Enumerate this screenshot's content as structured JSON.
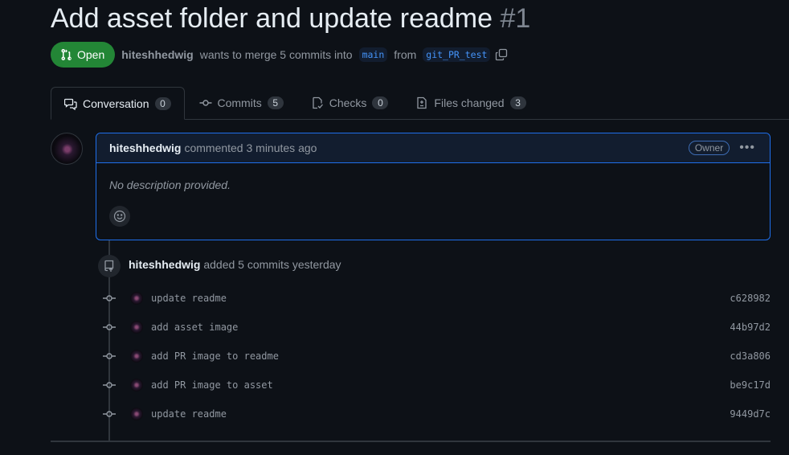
{
  "pr": {
    "title": "Add asset folder and update readme",
    "number": "#1",
    "state": "Open",
    "author": "hiteshhedwig",
    "merge_text": "wants to merge 5 commits into",
    "base_branch": "main",
    "from_text": "from",
    "head_branch": "git_PR_test"
  },
  "tabs": [
    {
      "label": "Conversation",
      "count": "0",
      "icon": "comment-discussion-icon"
    },
    {
      "label": "Commits",
      "count": "5",
      "icon": "git-commit-icon"
    },
    {
      "label": "Checks",
      "count": "0",
      "icon": "checklist-icon"
    },
    {
      "label": "Files changed",
      "count": "3",
      "icon": "file-diff-icon"
    }
  ],
  "comment": {
    "author": "hiteshhedwig",
    "action": "commented 3 minutes ago",
    "badge": "Owner",
    "body": "No description provided."
  },
  "event": {
    "author": "hiteshhedwig",
    "text": "added 5 commits yesterday"
  },
  "commits": [
    {
      "message": "update readme",
      "sha": "c628982"
    },
    {
      "message": "add asset image",
      "sha": "44b97d2"
    },
    {
      "message": "add PR image to readme",
      "sha": "cd3a806"
    },
    {
      "message": "add PR image to asset",
      "sha": "be9c17d"
    },
    {
      "message": "update readme",
      "sha": "9449d7c"
    }
  ],
  "colors": {
    "background": "#0d1117",
    "open_green": "#238636",
    "accent_blue": "#1f6feb",
    "branch_blue": "#4493f8",
    "muted": "#9198a1"
  }
}
